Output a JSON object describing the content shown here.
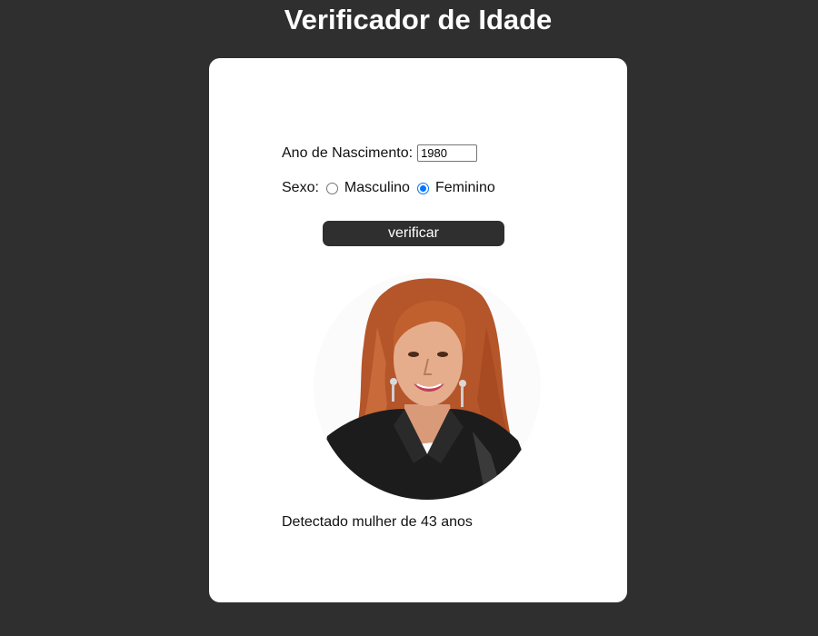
{
  "header": {
    "title": "Verificador de Idade"
  },
  "form": {
    "year_label": "Ano de Nascimento:",
    "year_value": "1980",
    "sex_label": "Sexo:",
    "options": [
      {
        "label": "Masculino",
        "checked": false
      },
      {
        "label": "Feminino",
        "checked": true
      }
    ],
    "verify_label": "verificar"
  },
  "result": {
    "text": "Detectado mulher de 43 anos"
  },
  "colors": {
    "background": "#2f2f2f",
    "card": "#ffffff",
    "accent": "#0075ff"
  },
  "icons": {
    "photo": "woman-portrait-photo"
  }
}
